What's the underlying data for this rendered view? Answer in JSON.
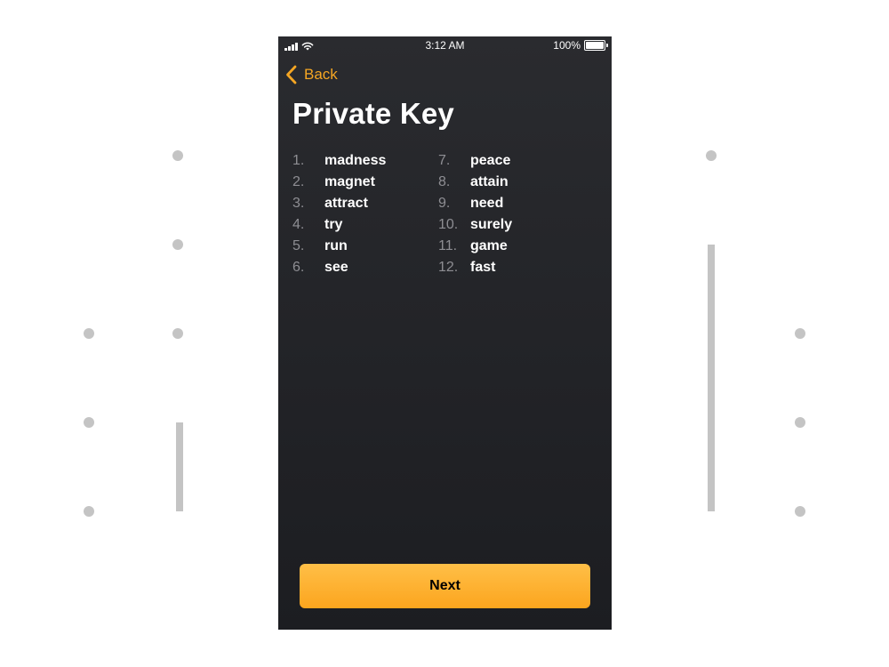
{
  "status_bar": {
    "time": "3:12 AM",
    "battery": "100%",
    "battery_level": 1.0
  },
  "navigation": {
    "back_label": "Back",
    "back_icon": "chevron-left-icon"
  },
  "page_title": "Private Key",
  "words": {
    "left": [
      {
        "num": "1.",
        "word": "madness"
      },
      {
        "num": "2.",
        "word": "magnet"
      },
      {
        "num": "3.",
        "word": "attract"
      },
      {
        "num": "4.",
        "word": "try"
      },
      {
        "num": "5.",
        "word": "run"
      },
      {
        "num": "6.",
        "word": "see"
      }
    ],
    "right": [
      {
        "num": "7.",
        "word": "peace"
      },
      {
        "num": "8.",
        "word": "attain"
      },
      {
        "num": "9.",
        "word": "need"
      },
      {
        "num": "10.",
        "word": "surely"
      },
      {
        "num": "11.",
        "word": "game"
      },
      {
        "num": "12.",
        "word": "fast"
      }
    ]
  },
  "next_button": {
    "label": "Next"
  },
  "colors": {
    "accent": "#f5a623",
    "background_top": "#2a2b2f",
    "background_bottom": "#1c1d21",
    "number_gray": "#8e8e93",
    "decor_gray": "#c4c4c4"
  }
}
